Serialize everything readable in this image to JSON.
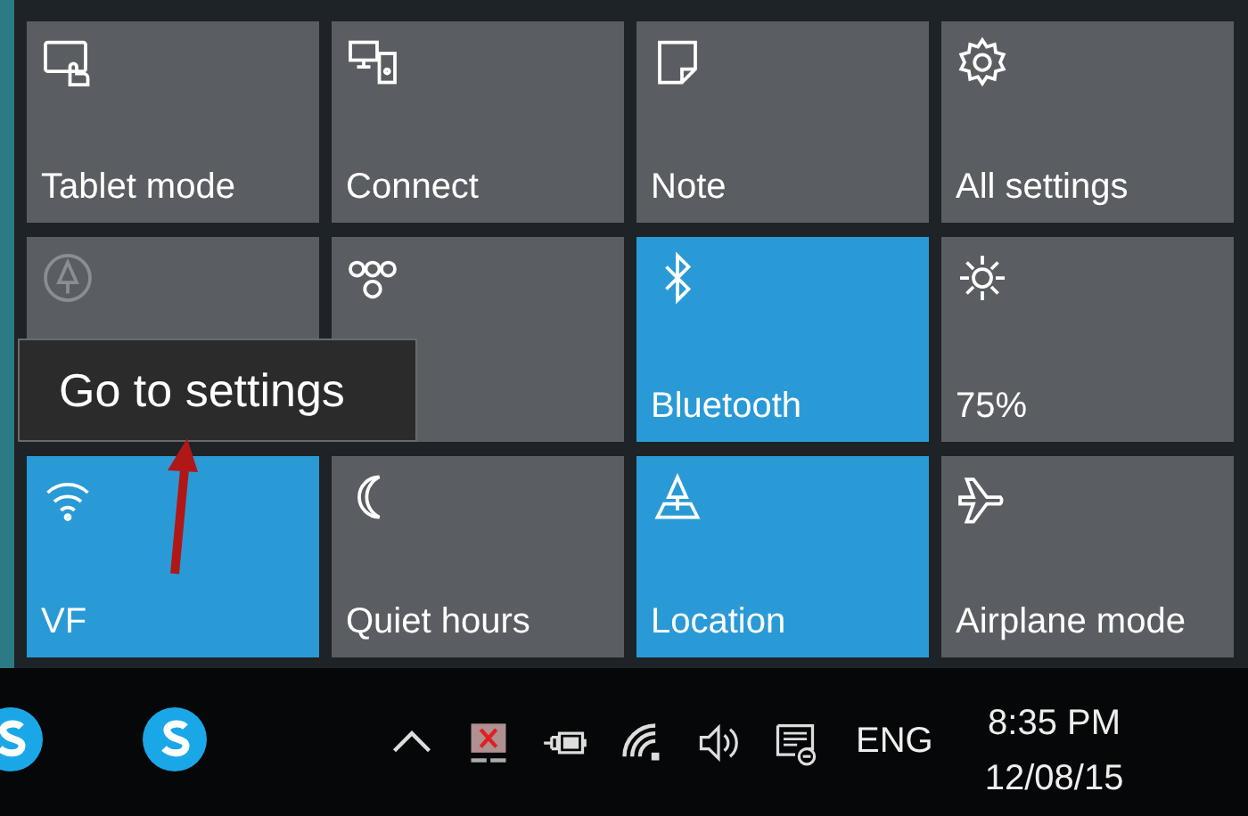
{
  "tiles": [
    {
      "label": "Tablet mode",
      "on": false,
      "disabled": false
    },
    {
      "label": "Connect",
      "on": false,
      "disabled": false
    },
    {
      "label": "Note",
      "on": false,
      "disabled": false
    },
    {
      "label": "All settings",
      "on": false,
      "disabled": false
    },
    {
      "on": false,
      "disabled": true
    },
    {
      "on": false,
      "disabled": false
    },
    {
      "label": "Bluetooth",
      "on": true,
      "disabled": false
    },
    {
      "label": "75%",
      "on": false,
      "disabled": false
    },
    {
      "label": "VF",
      "on": true,
      "disabled": false
    },
    {
      "label": "Quiet hours",
      "on": false,
      "disabled": false
    },
    {
      "label": "Location",
      "on": true,
      "disabled": false
    },
    {
      "label": "Airplane mode",
      "on": false,
      "disabled": false
    }
  ],
  "tooltip": {
    "text": "Go to settings"
  },
  "taskbar": {
    "language": "ENG",
    "time": "8:35 PM",
    "date": "12/08/15"
  }
}
